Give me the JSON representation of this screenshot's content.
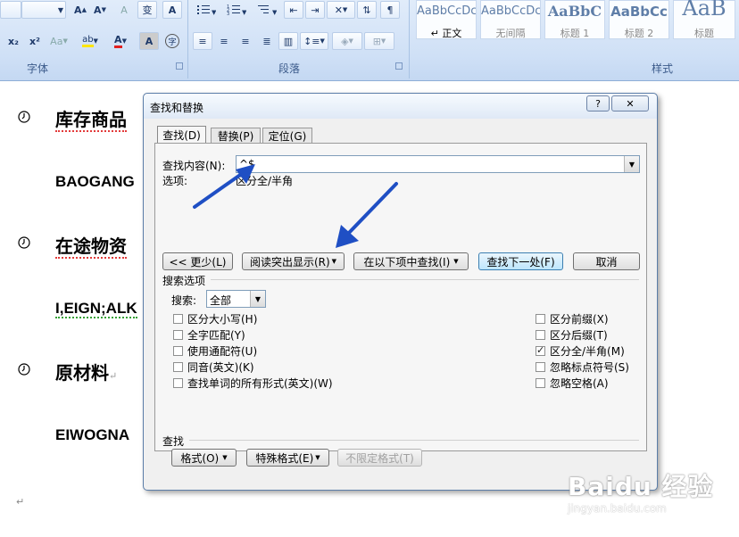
{
  "ribbon": {
    "font_group_label": "字体",
    "paragraph_group_label": "段落",
    "styles_group_label": "样式",
    "font_buttons": {
      "grow": "A",
      "shrink": "A",
      "clear": "A",
      "phonetic": "变",
      "border": "A",
      "subscript": "x₂",
      "superscript": "x²",
      "change_case": "Aa",
      "highlight": "ab",
      "font_color": "A",
      "shading": "A",
      "enclose": "字"
    },
    "styles": [
      {
        "sample": "AaBbCcDc",
        "name": "↵ 正文"
      },
      {
        "sample": "AaBbCcDc",
        "name": "无间隔"
      },
      {
        "sample": "AaBbC",
        "name": "标题 1"
      },
      {
        "sample": "AaBbCc",
        "name": "标题 2"
      },
      {
        "sample": "AaB",
        "name": "标题"
      }
    ]
  },
  "document": {
    "heading1": "库存商品",
    "text1": "BAOGANG",
    "heading2": "在途物资",
    "text2": "I,EIGN;ALK",
    "heading3": "原材料",
    "heading3_mark": "↵",
    "text3": "EIWOGNA",
    "paragraph_mark": "↵"
  },
  "dialog": {
    "title": "查找和替换",
    "help_button": "?",
    "close_button": "✕",
    "tabs": [
      "查找(D)",
      "替换(P)",
      "定位(G)"
    ],
    "find_label": "查找内容(N):",
    "find_value": "^$",
    "options_label": "选项:",
    "options_value": "区分全/半角",
    "buttons": {
      "less": "<< 更少(L)",
      "reading_highlight": "阅读突出显示(R)",
      "find_in": "在以下项中查找(I)",
      "find_next": "查找下一处(F)",
      "cancel": "取消"
    },
    "search_options_label": "搜索选项",
    "search_label": "搜索:",
    "search_value": "全部",
    "left_options": [
      {
        "label": "区分大小写(H)",
        "checked": false
      },
      {
        "label": "全字匹配(Y)",
        "checked": false
      },
      {
        "label": "使用通配符(U)",
        "checked": false
      },
      {
        "label": "同音(英文)(K)",
        "checked": false
      },
      {
        "label": "查找单词的所有形式(英文)(W)",
        "checked": false
      }
    ],
    "right_options": [
      {
        "label": "区分前缀(X)",
        "checked": false
      },
      {
        "label": "区分后缀(T)",
        "checked": false
      },
      {
        "label": "区分全/半角(M)",
        "checked": true
      },
      {
        "label": "忽略标点符号(S)",
        "checked": false
      },
      {
        "label": "忽略空格(A)",
        "checked": false
      }
    ],
    "find_section_label": "查找",
    "bottom_buttons": {
      "format": "格式(O)",
      "special": "特殊格式(E)",
      "no_format": "不限定格式(T)"
    }
  },
  "watermark": {
    "logo": "Baidu 经验",
    "url": "jingyan.baidu.com"
  },
  "colors": {
    "annotation_arrow": "#1f4fc4",
    "ribbon": "#cfe0f6",
    "spell_error": "#e23a3a"
  }
}
